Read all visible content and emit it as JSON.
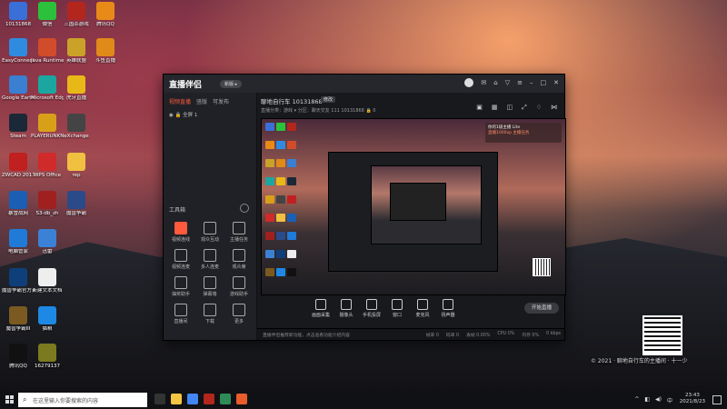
{
  "desktop": {
    "icons": [
      {
        "label": "10131868",
        "color": "#3a6fd8"
      },
      {
        "label": "微信",
        "color": "#2cc13b"
      },
      {
        "label": "三国杀游戏",
        "color": "#b3261e"
      },
      {
        "label": "腾讯QQ",
        "color": "#e88a18"
      },
      {
        "label": "EasyConnect",
        "color": "#2f8be0"
      },
      {
        "label": "Java Runtime",
        "color": "#d14c2a"
      },
      {
        "label": "英雄联盟",
        "color": "#c9a227"
      },
      {
        "label": "斗鱼直播",
        "color": "#e08a1a"
      },
      {
        "label": "Google Earth Pro",
        "color": "#3a7fd1"
      },
      {
        "label": "Microsoft Edge",
        "color": "#1ba7a0"
      },
      {
        "label": "虎牙直播",
        "color": "#e8b818"
      },
      {
        "label": "Steam",
        "color": "#1b2838"
      },
      {
        "label": "PLAYERUNKNOWN BATTLEGR",
        "color": "#d8a018"
      },
      {
        "label": "eXchange",
        "color": "#444444"
      },
      {
        "label": "ZWCAD 2017",
        "color": "#c02020"
      },
      {
        "label": "WPS Office",
        "color": "#d02a2a"
      },
      {
        "label": "rep",
        "color": "#f0c040"
      },
      {
        "label": "暴雪战网",
        "color": "#1a5fb4"
      },
      {
        "label": "S3-db_zh",
        "color": "#a02020"
      },
      {
        "label": "魔兽争霸",
        "color": "#2b4a8a"
      },
      {
        "label": "电脑管家",
        "color": "#1f7ad8"
      },
      {
        "label": "迅雷",
        "color": "#3b82d6"
      },
      {
        "label": "魔兽争霸官方对战平台",
        "color": "#0f3f7a"
      },
      {
        "label": "新建文本文档",
        "color": "#eeeeee"
      },
      {
        "label": "魔兽争霸III",
        "color": "#7a5a20"
      },
      {
        "label": "猫粮",
        "color": "#1e88e5"
      },
      {
        "label": "腾讯QQ",
        "color": "#111111"
      },
      {
        "label": "16279137",
        "color": "#7a7a20"
      }
    ]
  },
  "app": {
    "brand": "直播伴侣",
    "badge": "新版 ▸",
    "tabs": [
      "视频直播",
      "竖版",
      "可发布"
    ],
    "scene_item": "全屏 1",
    "tools_title": "工具箱",
    "tools": [
      {
        "label": "视频连线",
        "hot": true
      },
      {
        "label": "观众互动"
      },
      {
        "label": "主播任务"
      },
      {
        "label": "视频连麦"
      },
      {
        "label": "多人连麦"
      },
      {
        "label": "观众席"
      },
      {
        "label": "抽奖助手"
      },
      {
        "label": "弹幕墙"
      },
      {
        "label": "游戏助手"
      },
      {
        "label": "直播间"
      },
      {
        "label": "下载"
      },
      {
        "label": "更多"
      }
    ],
    "room_title": "聊地自行车 10131868",
    "room_edit": "修改",
    "info_row": "直播分类：游戏 ▾   分区：聊天交友 111   10131868   🔒 0",
    "tip_line1": "你的1级主播 Lite",
    "tip_line2": "直播1000xp 主播任务",
    "bottom_tools": [
      "画面采集",
      "摄像头",
      "手机投屏",
      "窗口",
      "麦克风",
      "扬声器"
    ],
    "start_button": "开始直播",
    "status_message": "直播伴侣推荐新功能，点击查看功能介绍内容",
    "stats": [
      "帧率 0",
      "码率 0",
      "丢帧 0.00%",
      "CPU 0%",
      "内存 0%",
      "0 kbps"
    ]
  },
  "watermark": "© 2021 · 聊地自行车的主播间 · 十一少",
  "taskbar": {
    "search_placeholder": "在这里输入你要搜索的内容",
    "apps": [
      {
        "name": "task-view",
        "color": "#333333"
      },
      {
        "name": "file-explorer",
        "color": "#f4c542"
      },
      {
        "name": "chrome",
        "color": "#4285f4"
      },
      {
        "name": "game-app",
        "color": "#b3261e"
      },
      {
        "name": "app-green",
        "color": "#2e8b57"
      },
      {
        "name": "live-companion",
        "color": "#e85d2b"
      }
    ],
    "time": "23:43",
    "date": "2021/8/23"
  }
}
